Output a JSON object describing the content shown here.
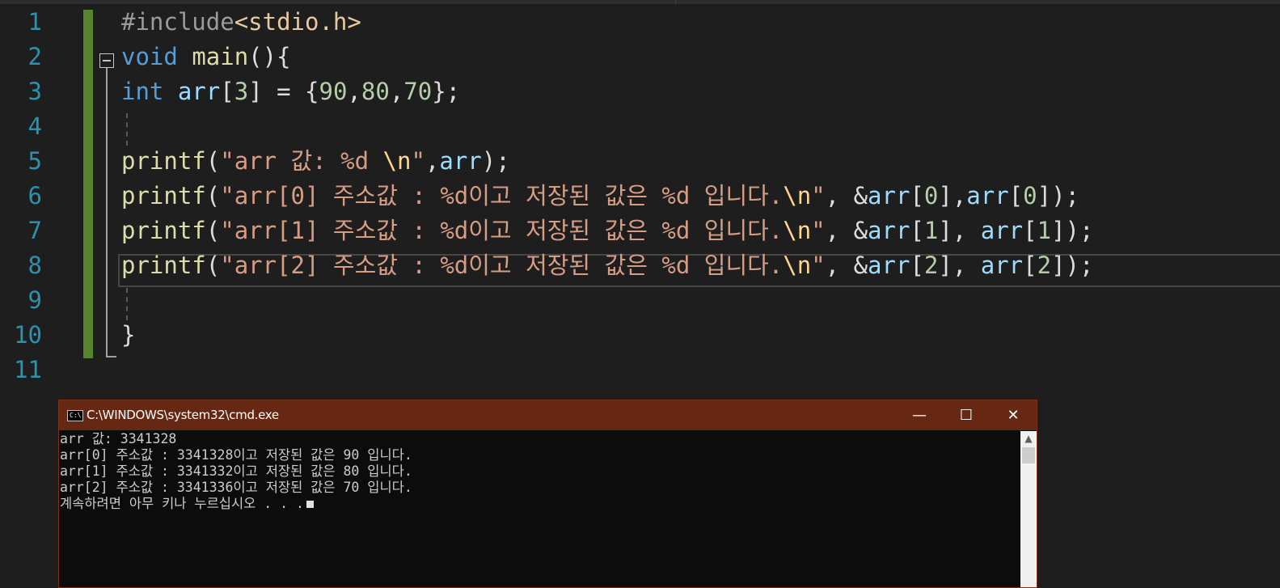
{
  "editor": {
    "line_numbers": [
      "1",
      "2",
      "3",
      "4",
      "5",
      "6",
      "7",
      "8",
      "9",
      "10",
      "11"
    ],
    "lines": [
      [
        [
          "pp",
          "#include"
        ],
        [
          "inc",
          "<stdio.h>"
        ]
      ],
      [
        [
          "kw",
          "void"
        ],
        [
          "pun",
          " "
        ],
        [
          "fn",
          "main"
        ],
        [
          "pun",
          "(){"
        ]
      ],
      [
        [
          "kw",
          "int"
        ],
        [
          "pun",
          " "
        ],
        [
          "var",
          "arr"
        ],
        [
          "pun",
          "["
        ],
        [
          "num",
          "3"
        ],
        [
          "pun",
          "] = {"
        ],
        [
          "num",
          "90"
        ],
        [
          "pun",
          ","
        ],
        [
          "num",
          "80"
        ],
        [
          "pun",
          ","
        ],
        [
          "num",
          "70"
        ],
        [
          "pun",
          "};"
        ]
      ],
      [],
      [
        [
          "fn",
          "printf"
        ],
        [
          "pun",
          "("
        ],
        [
          "str",
          "\"arr 값: %d "
        ],
        [
          "esc",
          "\\n"
        ],
        [
          "str",
          "\""
        ],
        [
          "pun",
          ","
        ],
        [
          "var",
          "arr"
        ],
        [
          "pun",
          ");"
        ]
      ],
      [
        [
          "fn",
          "printf"
        ],
        [
          "pun",
          "("
        ],
        [
          "str",
          "\"arr[0] 주소값 : %d이고 저장된 값은 %d 입니다."
        ],
        [
          "esc",
          "\\n"
        ],
        [
          "str",
          "\""
        ],
        [
          "pun",
          ", &"
        ],
        [
          "var",
          "arr"
        ],
        [
          "pun",
          "["
        ],
        [
          "num",
          "0"
        ],
        [
          "pun",
          "],"
        ],
        [
          "var",
          "arr"
        ],
        [
          "pun",
          "["
        ],
        [
          "num",
          "0"
        ],
        [
          "pun",
          "]);"
        ]
      ],
      [
        [
          "fn",
          "printf"
        ],
        [
          "pun",
          "("
        ],
        [
          "str",
          "\"arr[1] 주소값 : %d이고 저장된 값은 %d 입니다."
        ],
        [
          "esc",
          "\\n"
        ],
        [
          "str",
          "\""
        ],
        [
          "pun",
          ", &"
        ],
        [
          "var",
          "arr"
        ],
        [
          "pun",
          "["
        ],
        [
          "num",
          "1"
        ],
        [
          "pun",
          "], "
        ],
        [
          "var",
          "arr"
        ],
        [
          "pun",
          "["
        ],
        [
          "num",
          "1"
        ],
        [
          "pun",
          "]);"
        ]
      ],
      [
        [
          "fn",
          "printf"
        ],
        [
          "pun",
          "("
        ],
        [
          "str",
          "\"arr[2] 주소값 : %d이고 저장된 값은 %d 입니다."
        ],
        [
          "esc",
          "\\n"
        ],
        [
          "str",
          "\""
        ],
        [
          "pun",
          ", &"
        ],
        [
          "var",
          "arr"
        ],
        [
          "pun",
          "["
        ],
        [
          "num",
          "2"
        ],
        [
          "pun",
          "], "
        ],
        [
          "var",
          "arr"
        ],
        [
          "pun",
          "["
        ],
        [
          "num",
          "2"
        ],
        [
          "pun",
          "]);"
        ]
      ],
      [],
      [
        [
          "pun",
          "}"
        ]
      ],
      []
    ]
  },
  "console": {
    "icon": "cmd-prompt-icon",
    "icon_text": "C:\\",
    "title": "C:\\WINDOWS\\system32\\cmd.exe",
    "controls": {
      "minimize": "—",
      "maximize": "☐",
      "close": "✕"
    },
    "output": [
      "arr 값: 3341328",
      "arr[0] 주소값 : 3341328이고 저장된 값은 90 입니다.",
      "arr[1] 주소값 : 3341332이고 저장된 값은 80 입니다.",
      "arr[2] 주소값 : 3341336이고 저장된 값은 70 입니다.",
      "계속하려면 아무 키나 누르십시오 . . ."
    ],
    "scroll_up_glyph": "▲"
  },
  "colors": {
    "editor_bg": "#1e1e1e",
    "line_number": "#2b91af",
    "change_bar": "#57832f",
    "console_title_bg": "#662713",
    "console_bg": "#0c0c0c"
  }
}
